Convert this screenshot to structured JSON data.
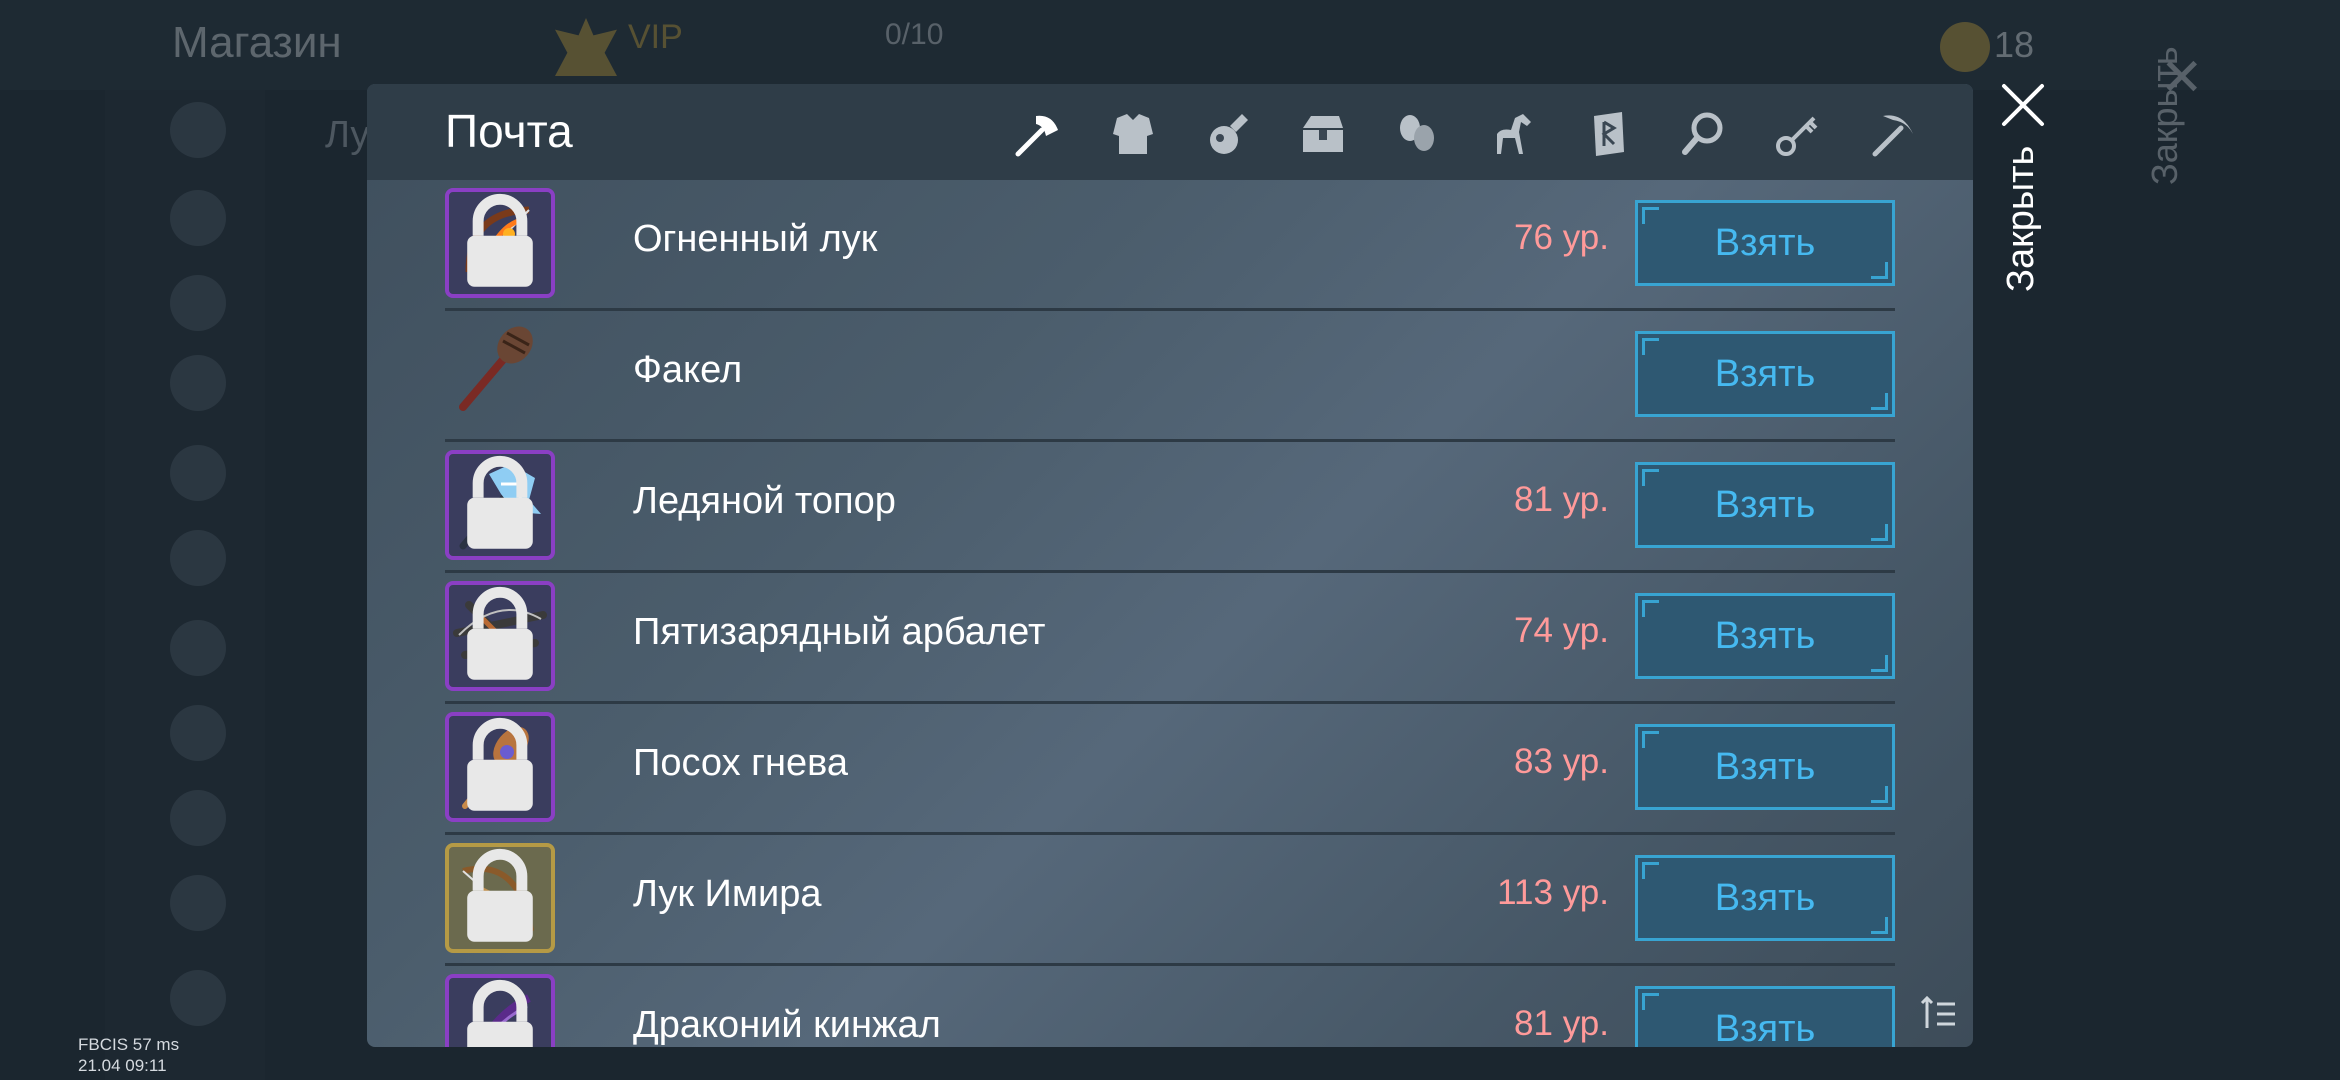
{
  "background": {
    "shop_title": "Магазин",
    "vip_label": "VIP",
    "vip_count": "0/10",
    "coins": "18",
    "tab_label": "Лу",
    "close_label": "Закрыть"
  },
  "debug": {
    "fps_line": "FBCIS 57 ms",
    "datetime_line": "21.04 09:11"
  },
  "mail": {
    "title": "Почта",
    "categories": [
      {
        "icon": "axe-icon",
        "active": true
      },
      {
        "icon": "armor-icon",
        "active": false
      },
      {
        "icon": "potion-icon",
        "active": false
      },
      {
        "icon": "chest-icon",
        "active": false
      },
      {
        "icon": "scrolls-icon",
        "active": false
      },
      {
        "icon": "horse-icon",
        "active": false
      },
      {
        "icon": "rune-icon",
        "active": false
      },
      {
        "icon": "magnifier-icon",
        "active": false
      },
      {
        "icon": "key-icon",
        "active": false
      },
      {
        "icon": "pickaxe-icon",
        "active": false
      }
    ],
    "items": [
      {
        "name": "Огненный лук",
        "level": "76 ур.",
        "frame": "purple",
        "locked": true,
        "icon": "fire-bow-icon"
      },
      {
        "name": "Факел",
        "level": "",
        "frame": "none",
        "locked": false,
        "icon": "torch-icon"
      },
      {
        "name": "Ледяной топор",
        "level": "81 ур.",
        "frame": "purple",
        "locked": true,
        "icon": "ice-axe-icon"
      },
      {
        "name": "Пятизарядный арбалет",
        "level": "74 ур.",
        "frame": "purple",
        "locked": true,
        "icon": "crossbow-icon"
      },
      {
        "name": "Посох гнева",
        "level": "83 ур.",
        "frame": "purple",
        "locked": true,
        "icon": "staff-icon"
      },
      {
        "name": "Лук Имира",
        "level": "113 ур.",
        "frame": "gold",
        "locked": true,
        "icon": "ymir-bow-icon"
      },
      {
        "name": "Драконий кинжал",
        "level": "81 ур.",
        "frame": "purple",
        "locked": true,
        "icon": "dagger-icon"
      }
    ],
    "take_label": "Взять",
    "close_label": "Закрыть"
  },
  "colors": {
    "accent_blue": "#46b9f0",
    "level_red": "#ff9a9a",
    "epic_purple": "#8a3fc4",
    "legendary_gold": "#b59a45"
  }
}
